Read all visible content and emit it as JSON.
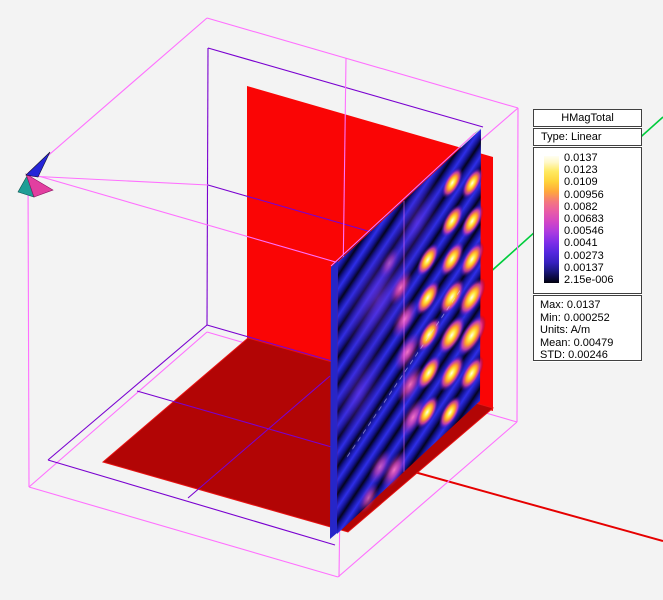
{
  "viewport": {
    "description": "3D EM-simulation view with boxed model, red substrate wall, red ground plane and HMagTotal field cut-plane"
  },
  "legend": {
    "title": "HMagTotal",
    "type_label": "Type: Linear",
    "scale_values": [
      "0.0137",
      "0.0123",
      "0.0109",
      "0.00956",
      "0.0082",
      "0.00683",
      "0.00546",
      "0.0041",
      "0.00273",
      "0.00137",
      "2.15e-006"
    ],
    "stats": {
      "max": "Max: 0.0137",
      "min": "Min: 0.000252",
      "units": "Units: A/m",
      "mean": "Mean: 0.00479",
      "std": "STD: 0.00246"
    }
  },
  "colors": {
    "viewport_bg": "#f3f3f3",
    "outer_box": "#ff6fff",
    "inner_box": "#7a00d0",
    "wall_red": "#fa0505",
    "floor_red": "#b20505",
    "axis_x": "#e60000",
    "axis_y": "#00cc3c",
    "triad_z_blue": "#2525d8",
    "triad_x_pink": "#e23fa0",
    "triad_y_teal": "#1f9e96"
  }
}
